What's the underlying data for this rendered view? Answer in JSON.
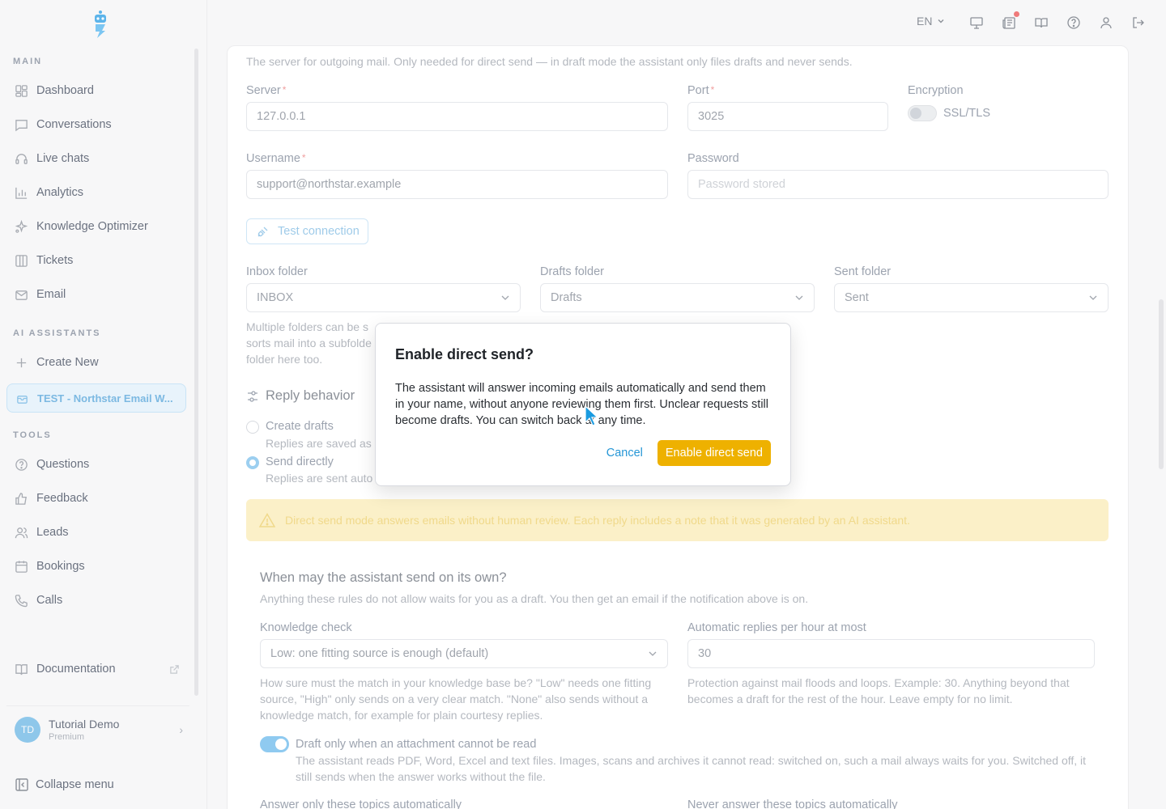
{
  "topbar": {
    "language": "EN"
  },
  "sidebar": {
    "section_main": "MAIN",
    "section_ai": "AI ASSISTANTS",
    "section_tools": "TOOLS",
    "main_items": [
      {
        "label": "Dashboard",
        "icon": "dashboard-icon"
      },
      {
        "label": "Conversations",
        "icon": "chat-icon"
      },
      {
        "label": "Live chats",
        "icon": "headset-icon"
      },
      {
        "label": "Analytics",
        "icon": "bar-chart-icon"
      },
      {
        "label": "Knowledge Optimizer",
        "icon": "sparkle-icon"
      },
      {
        "label": "Tickets",
        "icon": "kanban-icon"
      },
      {
        "label": "Email",
        "icon": "mail-icon"
      }
    ],
    "create_new": "Create New",
    "active_assistant": "TEST - Northstar Email W...",
    "tool_items": [
      {
        "label": "Questions",
        "icon": "question-icon"
      },
      {
        "label": "Feedback",
        "icon": "thumbs-up-icon"
      },
      {
        "label": "Leads",
        "icon": "users-icon"
      },
      {
        "label": "Bookings",
        "icon": "calendar-icon"
      },
      {
        "label": "Calls",
        "icon": "phone-icon"
      }
    ],
    "documentation": "Documentation",
    "user": {
      "initials": "TD",
      "name": "Tutorial Demo",
      "plan": "Premium"
    },
    "collapse": "Collapse menu"
  },
  "smtp": {
    "description": "The server for outgoing mail. Only needed for direct send — in draft mode the assistant only files drafts and never sends.",
    "server_label": "Server",
    "server_value": "127.0.0.1",
    "port_label": "Port",
    "port_value": "3025",
    "encryption_label": "Encryption",
    "encryption_option": "SSL/TLS",
    "username_label": "Username",
    "username_value": "support@northstar.example",
    "password_label": "Password",
    "password_placeholder": "Password stored",
    "test_button": "Test connection"
  },
  "folders": {
    "inbox_label": "Inbox folder",
    "inbox_value": "INBOX",
    "drafts_label": "Drafts folder",
    "drafts_value": "Drafts",
    "sent_label": "Sent folder",
    "sent_value": "Sent",
    "hint_line1": "Multiple folders can be s",
    "hint_line2": "sorts mail into a subfolde",
    "hint_line3": "folder here too."
  },
  "reply": {
    "title": "Reply behavior",
    "option1_label": "Create drafts",
    "option1_desc": "Replies are saved as",
    "option2_label": "Send directly",
    "option2_desc": "Replies are sent auto",
    "warning": "Direct send mode answers emails without human review. Each reply includes a note that it was generated by an AI assistant."
  },
  "rules": {
    "title": "When may the assistant send on its own?",
    "subtitle": "Anything these rules do not allow waits for you as a draft. You then get an email if the notification above is on.",
    "knowledge_label": "Knowledge check",
    "knowledge_value": "Low: one fitting source is enough (default)",
    "knowledge_help": "How sure must the match in your knowledge base be? \"Low\" needs one fitting source, \"High\" only sends on a very clear match. \"None\" also sends without a knowledge match, for example for plain courtesy replies.",
    "rate_label": "Automatic replies per hour at most",
    "rate_value": "30",
    "rate_help": "Protection against mail floods and loops. Example: 30. Anything beyond that becomes a draft for the rest of the hour. Leave empty for no limit.",
    "attachment_label": "Draft only when an attachment cannot be read",
    "attachment_help": "The assistant reads PDF, Word, Excel and text files. Images, scans and archives it cannot read: switched on, such a mail always waits for you. Switched off, it still sends when the answer works without the file.",
    "topics_allow_label": "Answer only these topics automatically",
    "topics_deny_label": "Never answer these topics automatically"
  },
  "dialog": {
    "title": "Enable direct send?",
    "body": "The assistant will answer incoming emails automatically and send them in your name, without anyone reviewing them first. Unclear requests still become drafts. You can switch back at any time.",
    "cancel": "Cancel",
    "confirm": "Enable direct send"
  },
  "colors": {
    "accent": "#2596d6",
    "primary_button": "#eeb100",
    "warning_bg": "#fbf0c8"
  }
}
